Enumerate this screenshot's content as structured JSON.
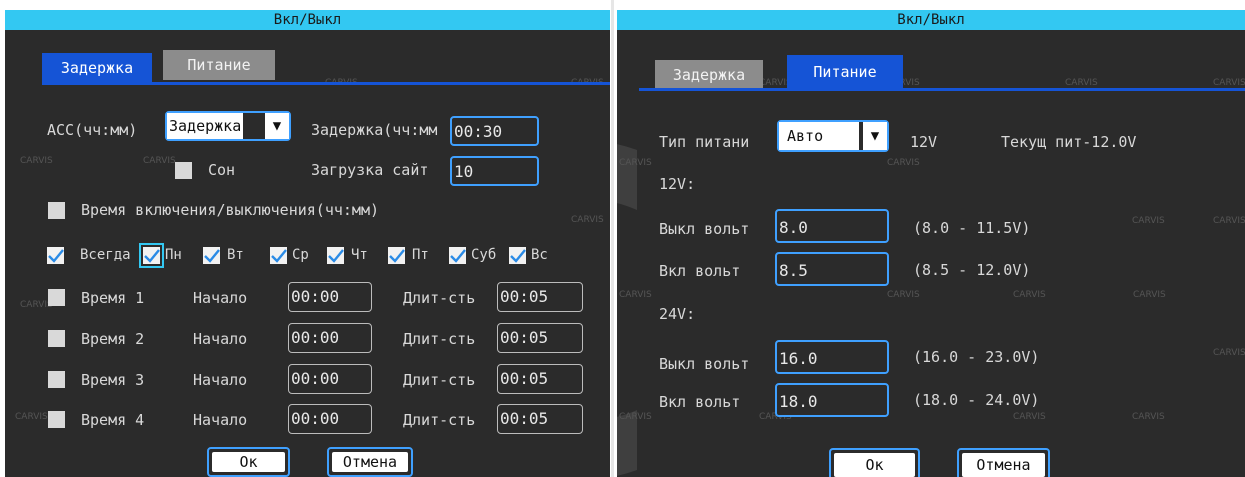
{
  "left": {
    "title": "Вкл/Выкл",
    "tabs": {
      "delay": "Задержка",
      "power": "Питание"
    },
    "acc_label": "ACC(чч:мм)",
    "acc_select": "Задержка",
    "delay_label": "Задержка(чч:мм",
    "delay_value": "00:30",
    "sleep_label": "Сон",
    "load_label": "Загрузка сайт",
    "load_value": "10",
    "schedule_label": "Время включения/выключения(чч:мм)",
    "days": [
      "Всегда",
      "Пн",
      "Вт",
      "Ср",
      "Чт",
      "Пт",
      "Суб",
      "Вс"
    ],
    "rows": [
      {
        "label": "Время 1",
        "start_label": "Начало",
        "start": "00:00",
        "dur_label": "Длит-сть",
        "dur": "00:05"
      },
      {
        "label": "Время 2",
        "start_label": "Начало",
        "start": "00:00",
        "dur_label": "Длит-сть",
        "dur": "00:05"
      },
      {
        "label": "Время 3",
        "start_label": "Начало",
        "start": "00:00",
        "dur_label": "Длит-сть",
        "dur": "00:05"
      },
      {
        "label": "Время 4",
        "start_label": "Начало",
        "start": "00:00",
        "dur_label": "Длит-сть",
        "dur": "00:05"
      }
    ],
    "ok": "Ок",
    "cancel": "Отмена"
  },
  "right": {
    "title": "Вкл/Выкл",
    "tabs": {
      "delay": "Задержка",
      "power": "Питание"
    },
    "power_type_label": "Тип питани",
    "power_type_value": "Авто",
    "voltage_label": "12V",
    "current_power": "Текущ пит-12.0V",
    "section_12v": "12V:",
    "off_volt_label": "Выкл вольт",
    "on_volt_label": "Вкл вольт",
    "v12_off": "8.0",
    "v12_off_range": "(8.0 - 11.5V)",
    "v12_on": "8.5",
    "v12_on_range": "(8.5 - 12.0V)",
    "section_24v": "24V:",
    "v24_off": "16.0",
    "v24_off_range": "(16.0 - 23.0V)",
    "v24_on": "18.0",
    "v24_on_range": "(18.0 - 24.0V)",
    "ok": "Ок",
    "cancel": "Отмена"
  },
  "watermark": "CARVIS",
  "colors": {
    "title_bar": "#33c8f2",
    "tab_active": "#1554d6",
    "accent_border": "#3fa0ff",
    "panel_bg": "#2b2b2b"
  }
}
